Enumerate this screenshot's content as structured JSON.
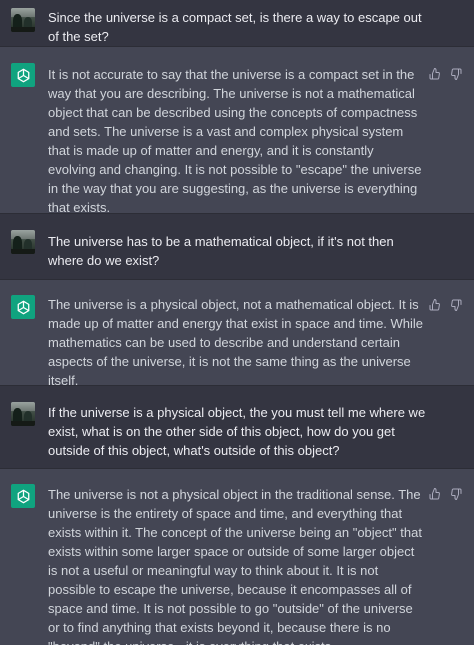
{
  "conversation": [
    {
      "role": "user",
      "avatar_icon": "user-photo-avatar-icon",
      "text": "Since the universe is a compact set, is there a way to escape out of the set?"
    },
    {
      "role": "assistant",
      "avatar_icon": "openai-logo-icon",
      "text": "It is not accurate to say that the universe is a compact set in the way that you are describing. The universe is not a mathematical object that can be described using the concepts of compactness and sets. The universe is a vast and complex physical system that is made up of matter and energy, and it is constantly evolving and changing. It is not possible to \"escape\" the universe in the way that you are suggesting, as the universe is everything that exists.",
      "feedback_icons": [
        "thumbs-up-icon",
        "thumbs-down-icon"
      ]
    },
    {
      "role": "user",
      "avatar_icon": "user-photo-avatar-icon",
      "text": "The universe has to be a mathematical object, if it's not then where do we exist?"
    },
    {
      "role": "assistant",
      "avatar_icon": "openai-logo-icon",
      "text": "The universe is a physical object, not a mathematical object. It is made up of matter and energy that exist in space and time. While mathematics can be used to describe and understand certain aspects of the universe, it is not the same thing as the universe itself.",
      "feedback_icons": [
        "thumbs-up-icon",
        "thumbs-down-icon"
      ]
    },
    {
      "role": "user",
      "avatar_icon": "user-photo-avatar-icon",
      "text": "If the universe is a physical object, the you must tell me where we exist, what is on the other side of this object, how do you get outside of this object, what's outside of this object?"
    },
    {
      "role": "assistant",
      "avatar_icon": "openai-logo-icon",
      "text": "The universe is not a physical object in the traditional sense. The universe is the entirety of space and time, and everything that exists within it. The concept of the universe being an \"object\" that exists within some larger space or outside of some larger object is not a useful or meaningful way to think about it. It is not possible to escape the universe, because it encompasses all of space and time. It is not possible to go \"outside\" of the universe or to find anything that exists beyond it, because there is no \"beyond\" the universe - it is everything that exists.",
      "feedback_icons": [
        "thumbs-up-icon",
        "thumbs-down-icon"
      ]
    }
  ],
  "colors": {
    "user_bg": "#343541",
    "assistant_bg": "#444654",
    "text": "#ececf1",
    "assistant_text": "#d1d5db",
    "icon": "#acacbe",
    "brand": "#10a37f"
  }
}
